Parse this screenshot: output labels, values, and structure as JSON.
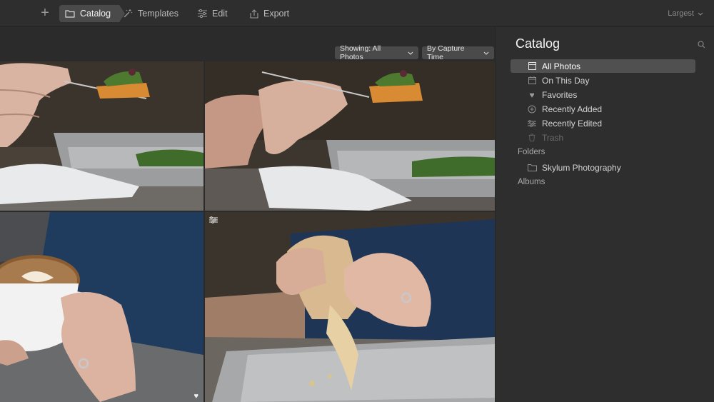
{
  "toolbar": {
    "add_label": "+",
    "catalog_label": "Catalog",
    "templates_label": "Templates",
    "edit_label": "Edit",
    "export_label": "Export",
    "size_label": "Largest"
  },
  "filters": {
    "showing_label": "Showing: All Photos",
    "sort_label": "By Capture Time"
  },
  "photos": [
    {
      "subject": "fork with toast and garnish over tray",
      "favorite": false,
      "edited": false
    },
    {
      "subject": "hand holding fork with toast over tray",
      "favorite": false,
      "edited": false
    },
    {
      "subject": "hands holding latte art cup",
      "favorite": true,
      "edited": false
    },
    {
      "subject": "hands tearing pastry over tray",
      "favorite": false,
      "edited": true
    }
  ],
  "panel": {
    "title": "Catalog",
    "items": [
      {
        "label": "All Photos",
        "icon": "photos-icon",
        "selected": true
      },
      {
        "label": "On This Day",
        "icon": "calendar-icon"
      },
      {
        "label": "Favorites",
        "icon": "heart-icon"
      },
      {
        "label": "Recently Added",
        "icon": "plus-circle-icon"
      },
      {
        "label": "Recently Edited",
        "icon": "sliders-icon"
      },
      {
        "label": "Trash",
        "icon": "trash-icon",
        "dim": true
      }
    ],
    "folders_label": "Folders",
    "folders": [
      {
        "label": "Skylum Photography",
        "icon": "folder-icon"
      }
    ],
    "albums_label": "Albums"
  },
  "colors": {
    "toolbar_bg": "#2e2e2e",
    "selected_bg": "#505050",
    "panel_bg": "#2e2e2e"
  }
}
